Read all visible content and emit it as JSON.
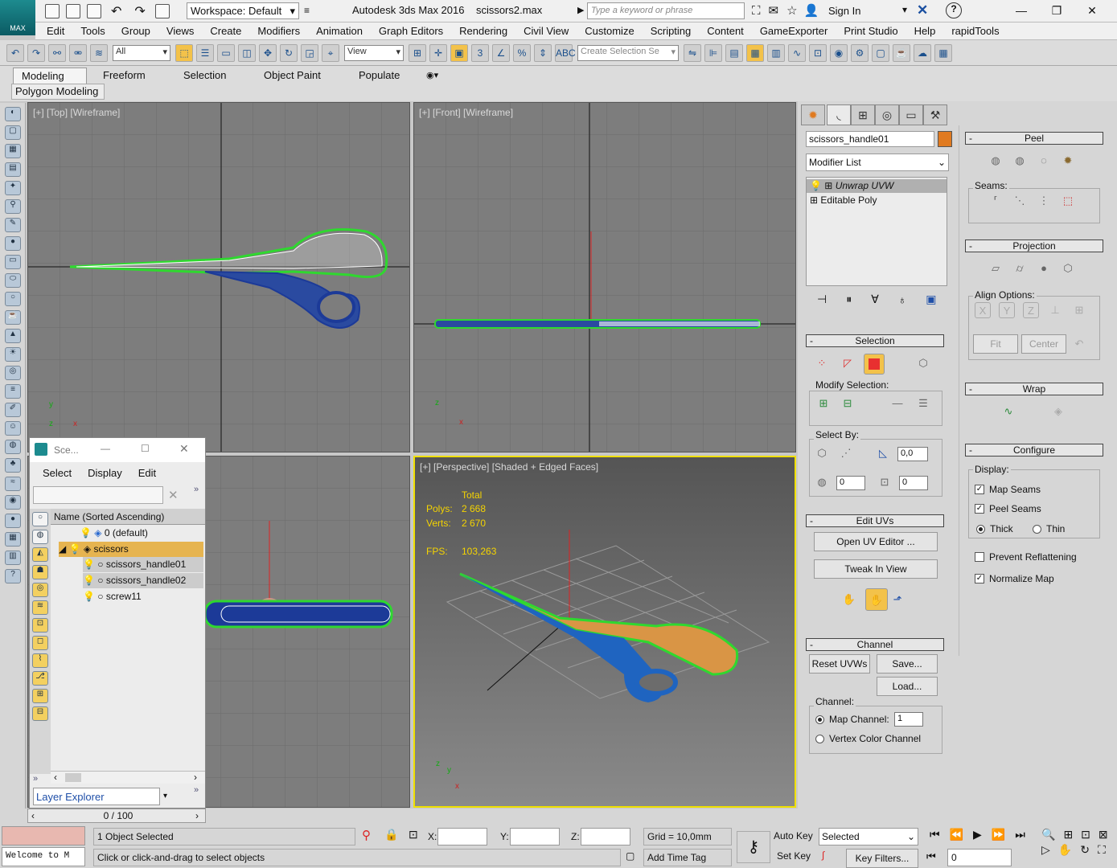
{
  "app": {
    "logo_label": "MAX",
    "workspace": "Workspace: Default",
    "title": "Autodesk 3ds Max 2016",
    "file": "scissors2.max",
    "search_placeholder": "Type a keyword or phrase",
    "sign_in": "Sign In"
  },
  "menu": [
    "Edit",
    "Tools",
    "Group",
    "Views",
    "Create",
    "Modifiers",
    "Animation",
    "Graph Editors",
    "Rendering",
    "Civil View",
    "Customize",
    "Scripting",
    "Content",
    "GameExporter",
    "Print Studio",
    "Help",
    "rapidTools"
  ],
  "toolbar": {
    "filter": "All",
    "ref_coord": "View",
    "selection_set": "Create Selection Se"
  },
  "ribbon": {
    "tabs": [
      "Modeling",
      "Freeform",
      "Selection",
      "Object Paint",
      "Populate"
    ],
    "sub": "Polygon Modeling"
  },
  "viewports": {
    "top": "[+] [Top] [Wireframe]",
    "front": "[+] [Front] [Wireframe]",
    "perspective": "[+] [Perspective] [Shaded + Edged Faces]",
    "stats": {
      "total_label": "Total",
      "polys_label": "Polys:",
      "polys": "2 668",
      "verts_label": "Verts:",
      "verts": "2 670",
      "fps_label": "FPS:",
      "fps": "103,263"
    }
  },
  "scene_explorer": {
    "title": "Sce...",
    "menus": [
      "Select",
      "Display",
      "Edit"
    ],
    "column": "Name (Sorted Ascending)",
    "rows": [
      "0 (default)",
      "scissors",
      "scissors_handle01",
      "scissors_handle02",
      "screw11"
    ],
    "footer": "Layer Explorer"
  },
  "modify_panel": {
    "object_name": "scissors_handle01",
    "object_color": "#e07a20",
    "modifier_list": "Modifier List",
    "stack": [
      "Unwrap UVW",
      "Editable Poly"
    ],
    "selection": {
      "title": "Selection",
      "modify_selection": "Modify Selection:",
      "select_by": "Select By:",
      "angle": "0,0",
      "v1": "0",
      "v2": "0"
    },
    "edit_uvs": {
      "title": "Edit UVs",
      "open_uv_editor": "Open UV Editor ...",
      "tweak_in_view": "Tweak In View"
    },
    "channel": {
      "title": "Channel",
      "reset": "Reset UVWs",
      "save": "Save...",
      "load": "Load...",
      "channel_label": "Channel:",
      "map_channel": "Map Channel:",
      "map_channel_value": "1",
      "vertex_color": "Vertex Color Channel"
    }
  },
  "right_panel": {
    "peel": "Peel",
    "seams": "Seams:",
    "projection": "Projection",
    "align_options": "Align Options:",
    "fit": "Fit",
    "center": "Center",
    "wrap": "Wrap",
    "configure": "Configure",
    "display": "Display:",
    "map_seams": "Map Seams",
    "peel_seams": "Peel Seams",
    "thick": "Thick",
    "thin": "Thin",
    "prevent_reflattening": "Prevent Reflattening",
    "normalize_map": "Normalize Map"
  },
  "status": {
    "time_slider": "0 / 100",
    "selected": "1 Object Selected",
    "prompt": "Click or click-and-drag to select objects",
    "welcome": "Welcome to M",
    "x_label": "X:",
    "y_label": "Y:",
    "z_label": "Z:",
    "grid": "Grid = 10,0mm",
    "add_time_tag": "Add Time Tag",
    "auto_key": "Auto Key",
    "set_key": "Set Key",
    "key_mode": "Selected",
    "key_filters": "Key Filters...",
    "frame": "0"
  }
}
